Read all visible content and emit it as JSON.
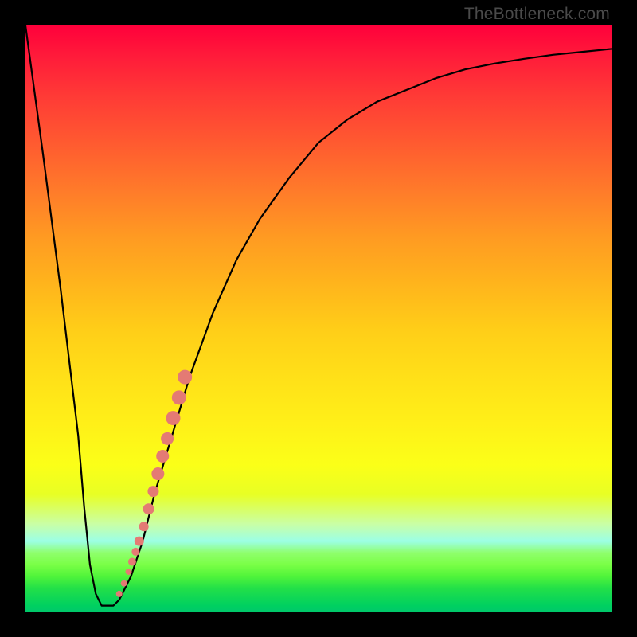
{
  "attribution": "TheBottleneck.com",
  "colors": {
    "frame": "#000000",
    "curve_stroke": "#000000",
    "dot_fill": "#e47a74"
  },
  "chart_data": {
    "type": "line",
    "title": "",
    "xlabel": "",
    "ylabel": "",
    "xlim": [
      0,
      100
    ],
    "ylim": [
      0,
      100
    ],
    "grid": false,
    "legend": false,
    "series": [
      {
        "name": "bottleneck-curve",
        "x": [
          0,
          3,
          6,
          9,
          10,
          11,
          12,
          13,
          14,
          15,
          16,
          18,
          20,
          22,
          25,
          28,
          32,
          36,
          40,
          45,
          50,
          55,
          60,
          65,
          70,
          75,
          80,
          85,
          90,
          95,
          100
        ],
        "y": [
          100,
          78,
          55,
          30,
          18,
          8,
          3,
          1,
          1,
          1,
          2,
          6,
          12,
          20,
          30,
          40,
          51,
          60,
          67,
          74,
          80,
          84,
          87,
          89,
          91,
          92.5,
          93.5,
          94.3,
          95,
          95.5,
          96
        ]
      }
    ],
    "points": [
      {
        "name": "dot-1",
        "x": 16.0,
        "y": 3.0,
        "r": 4
      },
      {
        "name": "dot-2",
        "x": 16.8,
        "y": 4.8,
        "r": 4
      },
      {
        "name": "dot-3",
        "x": 17.6,
        "y": 6.8,
        "r": 4
      },
      {
        "name": "dot-4",
        "x": 18.2,
        "y": 8.5,
        "r": 5
      },
      {
        "name": "dot-5",
        "x": 18.8,
        "y": 10.2,
        "r": 5
      },
      {
        "name": "dot-6",
        "x": 19.4,
        "y": 12.0,
        "r": 6
      },
      {
        "name": "dot-7",
        "x": 20.2,
        "y": 14.5,
        "r": 6
      },
      {
        "name": "dot-8",
        "x": 21.0,
        "y": 17.5,
        "r": 7
      },
      {
        "name": "dot-9",
        "x": 21.8,
        "y": 20.5,
        "r": 7
      },
      {
        "name": "dot-10",
        "x": 22.6,
        "y": 23.5,
        "r": 8
      },
      {
        "name": "dot-11",
        "x": 23.4,
        "y": 26.5,
        "r": 8
      },
      {
        "name": "dot-12",
        "x": 24.2,
        "y": 29.5,
        "r": 8
      },
      {
        "name": "dot-13",
        "x": 25.2,
        "y": 33.0,
        "r": 9
      },
      {
        "name": "dot-14",
        "x": 26.2,
        "y": 36.5,
        "r": 9
      },
      {
        "name": "dot-15",
        "x": 27.2,
        "y": 40.0,
        "r": 9
      }
    ]
  }
}
